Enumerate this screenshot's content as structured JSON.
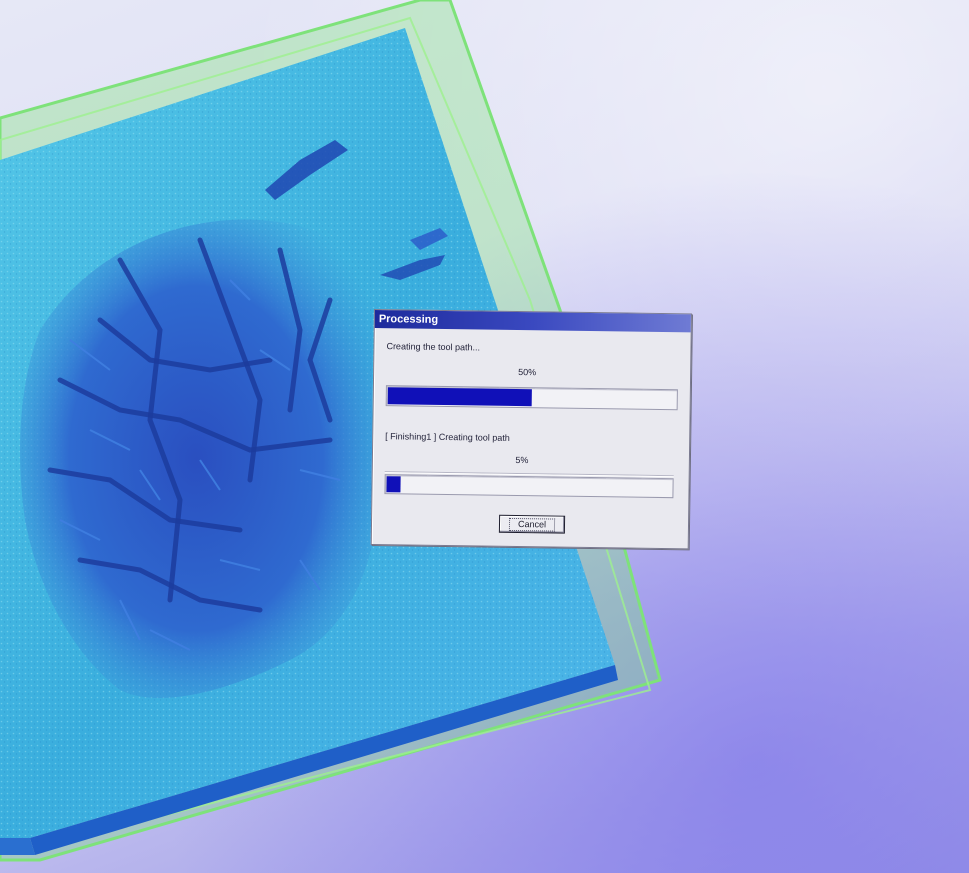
{
  "dialog": {
    "title": "Processing",
    "overall_message": "Creating the tool path...",
    "overall_percent_label": "50%",
    "overall_progress": 0.5,
    "step_message": "[ Finishing1 ] Creating tool path",
    "step_percent_label": "5%",
    "step_progress": 0.05,
    "cancel_label": "Cancel"
  },
  "colors": {
    "titlebar_start": "#1d2a9c",
    "progress_fill": "#1010b8",
    "model_bounding_box": "#7ee27a",
    "terrain_surface": "#3fb4d8",
    "terrain_relief": "#2a58c8"
  }
}
